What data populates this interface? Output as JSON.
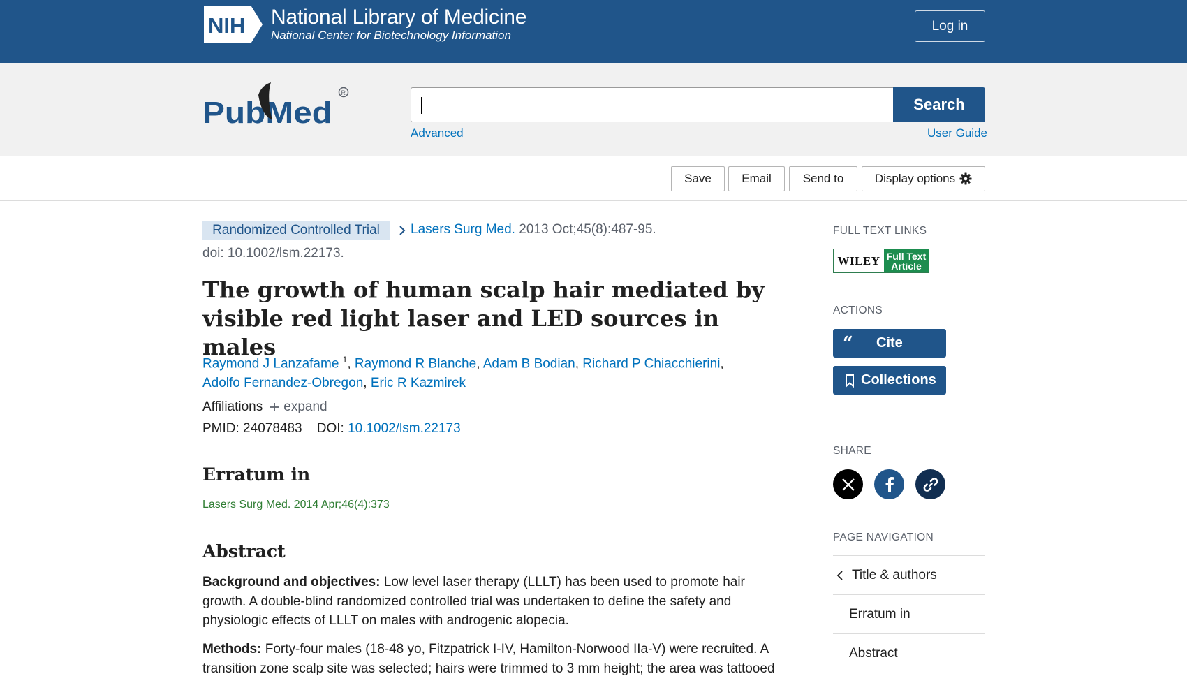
{
  "header": {
    "logo_text": "NIH",
    "title": "National Library of Medicine",
    "subtitle": "National Center for Biotechnology Information",
    "login_label": "Log in"
  },
  "search": {
    "logo_text": "PubMed",
    "query": "",
    "button_label": "Search",
    "advanced_label": "Advanced",
    "user_guide_label": "User Guide"
  },
  "toolbar": {
    "save_label": "Save",
    "email_label": "Email",
    "send_to_label": "Send to",
    "display_options_label": "Display options"
  },
  "article": {
    "publication_type": "Randomized Controlled Trial",
    "journal": "Lasers Surg Med.",
    "citation": " 2013 Oct;45(8):487-95.",
    "doi_line": "doi: 10.1002/lsm.22173.",
    "title": "The growth of human scalp hair mediated by visible red light laser and LED sources in males",
    "authors": [
      "Raymond J Lanzafame",
      "Raymond R Blanche",
      "Adam B Bodian",
      "Richard P Chiacchierini",
      "Adolfo Fernandez-Obregon",
      "Eric R Kazmirek"
    ],
    "first_author_affiliation": "1",
    "affiliations_label": "Affiliations",
    "expand_label": "expand",
    "pmid_label": "PMID: 24078483",
    "doi_label": "DOI:",
    "doi_value": "10.1002/lsm.22173",
    "erratum_heading": "Erratum in",
    "erratum_citation": "Lasers Surg Med. 2014 Apr;46(4):373",
    "abstract_heading": "Abstract",
    "abstract": [
      {
        "label": "Background and objectives:",
        "text": " Low level laser therapy (LLLT) has been used to promote hair growth. A double-blind randomized controlled trial was undertaken to define the safety and physiologic effects of LLLT on males with androgenic alopecia."
      },
      {
        "label": "Methods:",
        "text": " Forty-four males (18-48 yo, Fitzpatrick I-IV, Hamilton-Norwood IIa-V) were recruited. A transition zone scalp site was selected; hairs were trimmed to 3 mm height; the area was tattooed"
      }
    ]
  },
  "sidebar": {
    "full_text_heading": "FULL TEXT LINKS",
    "wiley_name": "WILEY",
    "wiley_line1": "Full Text",
    "wiley_line2": "Article",
    "actions_heading": "ACTIONS",
    "cite_label": "Cite",
    "collections_label": "Collections",
    "share_heading": "SHARE",
    "page_nav_heading": "PAGE NAVIGATION",
    "nav_items": [
      "Title & authors",
      "Erratum in",
      "Abstract"
    ]
  },
  "colors": {
    "brand_blue": "#20558a",
    "link_blue": "#0071bc",
    "erratum_green": "#2e7d32",
    "wiley_green": "#1d8d4f"
  },
  "icons": [
    "nih-logo-icon",
    "pubmed-logo-icon",
    "gear-icon",
    "chevron-right-icon",
    "plus-icon",
    "quote-icon",
    "bookmark-icon",
    "x-icon",
    "facebook-icon",
    "link-icon",
    "chevron-left-icon"
  ]
}
